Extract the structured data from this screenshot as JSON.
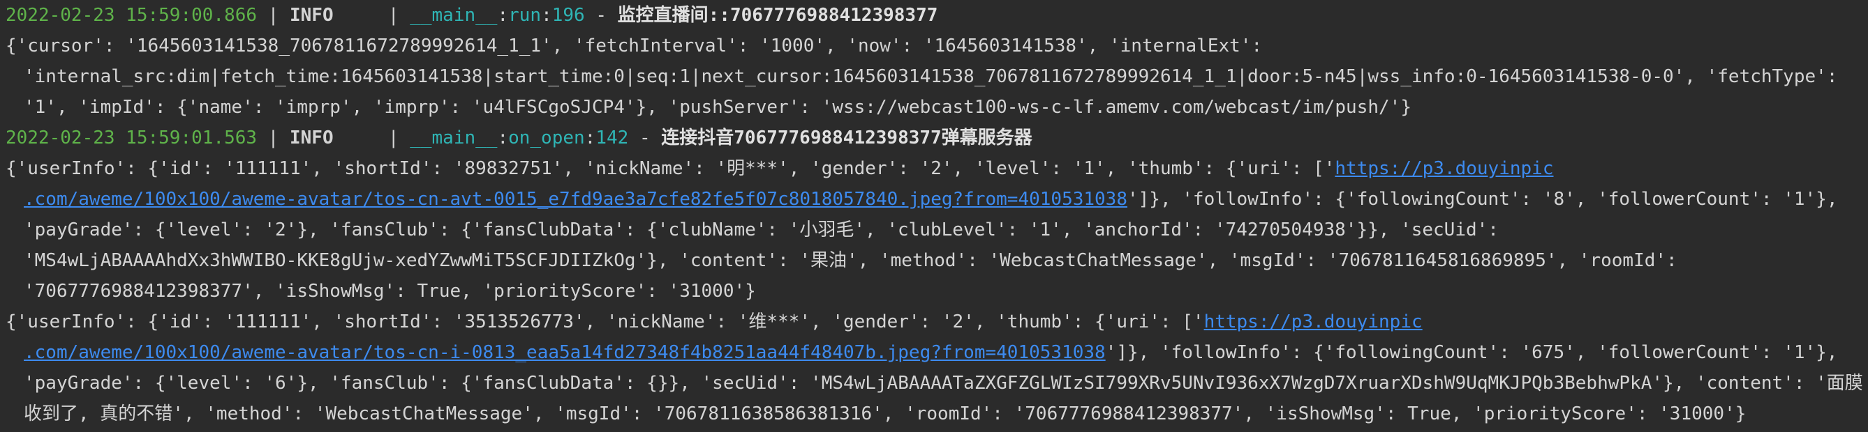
{
  "log_entries": [
    {
      "type": "header",
      "timestamp": "2022-02-23 15:59:00.866",
      "level": "INFO",
      "module": "__main__",
      "func": "run",
      "line": "196",
      "message": "监控直播间::7067776988412398377"
    },
    {
      "type": "body",
      "lines": [
        "{'cursor': '1645603141538_7067811672789992614_1_1', 'fetchInterval': '1000', 'now': '1645603141538', 'internalExt':",
        "'internal_src:dim|fetch_time:1645603141538|start_time:0|seq:1|next_cursor:1645603141538_7067811672789992614_1_1|door:5-n45|wss_info:0-1645603141538-0-0', 'fetchType':",
        "'1', 'impId': {'name': 'imprp', 'imprp': 'u4lFSCgoSJCP4'}, 'pushServer': 'wss://webcast100-ws-c-lf.amemv.com/webcast/im/push/'}"
      ]
    },
    {
      "type": "header",
      "timestamp": "2022-02-23 15:59:01.563",
      "level": "INFO",
      "module": "__main__",
      "func": "on_open",
      "line": "142",
      "message": "连接抖音7067776988412398377弹幕服务器"
    },
    {
      "type": "body_link",
      "line1_prefix": "{'userInfo': {'id': '111111', 'shortId': '89832751', 'nickName': '明***', 'gender': '2', 'level': '1', 'thumb': {'uri': ['",
      "line1_link": "https://p3.douyinpic",
      "line2_link": ".com/aweme/100x100/aweme-avatar/tos-cn-avt-0015_e7fd9ae3a7cfe82fe5f07c8018057840.jpeg?from=4010531038",
      "line2_suffix": "']}, 'followInfo': {'followingCount': '8', 'followerCount': '1'},",
      "rest": [
        "'payGrade': {'level': '2'}, 'fansClub': {'fansClubData': {'clubName': '小羽毛', 'clubLevel': '1', 'anchorId': '74270504938'}}, 'secUid':",
        "'MS4wLjABAAAAhdXx3hWWIBO-KKE8gUjw-xedYZwwMiT5SCFJDIIZkOg'}, 'content': '果油', 'method': 'WebcastChatMessage', 'msgId': '7067811645816869895', 'roomId':",
        "'7067776988412398377', 'isShowMsg': True, 'priorityScore': '31000'}"
      ]
    },
    {
      "type": "body_link",
      "line1_prefix": "{'userInfo': {'id': '111111', 'shortId': '3513526773', 'nickName': '维***', 'gender': '2', 'thumb': {'uri': ['",
      "line1_link": "https://p3.douyinpic",
      "line2_link": ".com/aweme/100x100/aweme-avatar/tos-cn-i-0813_eaa5a14fd27348f4b8251aa44f48407b.jpeg?from=4010531038",
      "line2_suffix": "']}, 'followInfo': {'followingCount': '675', 'followerCount': '1'},",
      "rest": [
        "'payGrade': {'level': '6'}, 'fansClub': {'fansClubData': {}}, 'secUid': 'MS4wLjABAAAATaZXGFZGLWIzSI799XRv5UNvI936xX7WzgD7XruarXDshW9UqMKJPQb3BebhwPkA'}, 'content': '面膜",
        "收到了, 真的不错', 'method': 'WebcastChatMessage', 'msgId': '7067811638586381316', 'roomId': '7067776988412398377', 'isShowMsg': True, 'priorityScore': '31000'}"
      ]
    }
  ]
}
